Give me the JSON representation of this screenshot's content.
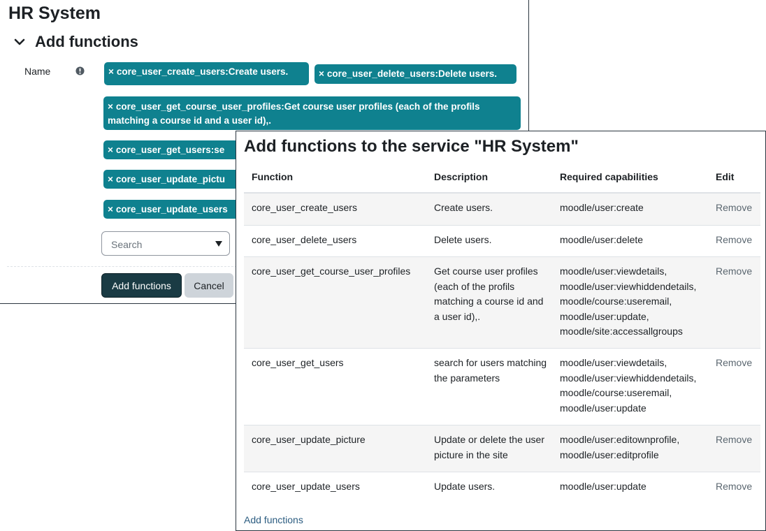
{
  "form": {
    "title": "HR System",
    "section_title": "Add functions",
    "name_label": "Name",
    "tags": [
      "core_user_create_users:Create users.",
      "core_user_delete_users:Delete users.",
      "core_user_get_course_user_profiles:Get course user profiles (each of the profils matching a course id and a user id),.",
      "core_user_get_users:se",
      "core_user_update_pictu",
      "core_user_update_users"
    ],
    "tag_remove_glyph": "×",
    "search_placeholder": "Search",
    "add_button": "Add functions",
    "cancel_button": "Cancel"
  },
  "table_panel": {
    "title": "Add functions to the service \"HR System\"",
    "columns": [
      "Function",
      "Description",
      "Required capabilities",
      "Edit"
    ],
    "rows": [
      {
        "function": "core_user_create_users",
        "description": "Create users.",
        "capabilities": "moodle/user:create",
        "edit": "Remove"
      },
      {
        "function": "core_user_delete_users",
        "description": "Delete users.",
        "capabilities": "moodle/user:delete",
        "edit": "Remove"
      },
      {
        "function": "core_user_get_course_user_profiles",
        "description": "Get course user profiles (each of the profils matching a course id and a user id),.",
        "capabilities": "moodle/user:viewdetails, moodle/user:viewhiddendetails, moodle/course:useremail, moodle/user:update, moodle/site:accessallgroups",
        "edit": "Remove"
      },
      {
        "function": "core_user_get_users",
        "description": "search for users matching the parameters",
        "capabilities": "moodle/user:viewdetails, moodle/user:viewhiddendetails, moodle/course:useremail, moodle/user:update",
        "edit": "Remove"
      },
      {
        "function": "core_user_update_picture",
        "description": "Update or delete the user picture in the site",
        "capabilities": "moodle/user:editownprofile, moodle/user:editprofile",
        "edit": "Remove"
      },
      {
        "function": "core_user_update_users",
        "description": "Update users.",
        "capabilities": "moodle/user:update",
        "edit": "Remove"
      }
    ],
    "add_link": "Add functions"
  },
  "colors": {
    "tag_bg": "#0f818f",
    "primary_button": "#1a3b44",
    "secondary_button": "#ced4da",
    "link": "#2b5c80"
  },
  "icons": [
    "chevron-down-icon",
    "info-icon",
    "close-icon",
    "caret-down-icon"
  ]
}
